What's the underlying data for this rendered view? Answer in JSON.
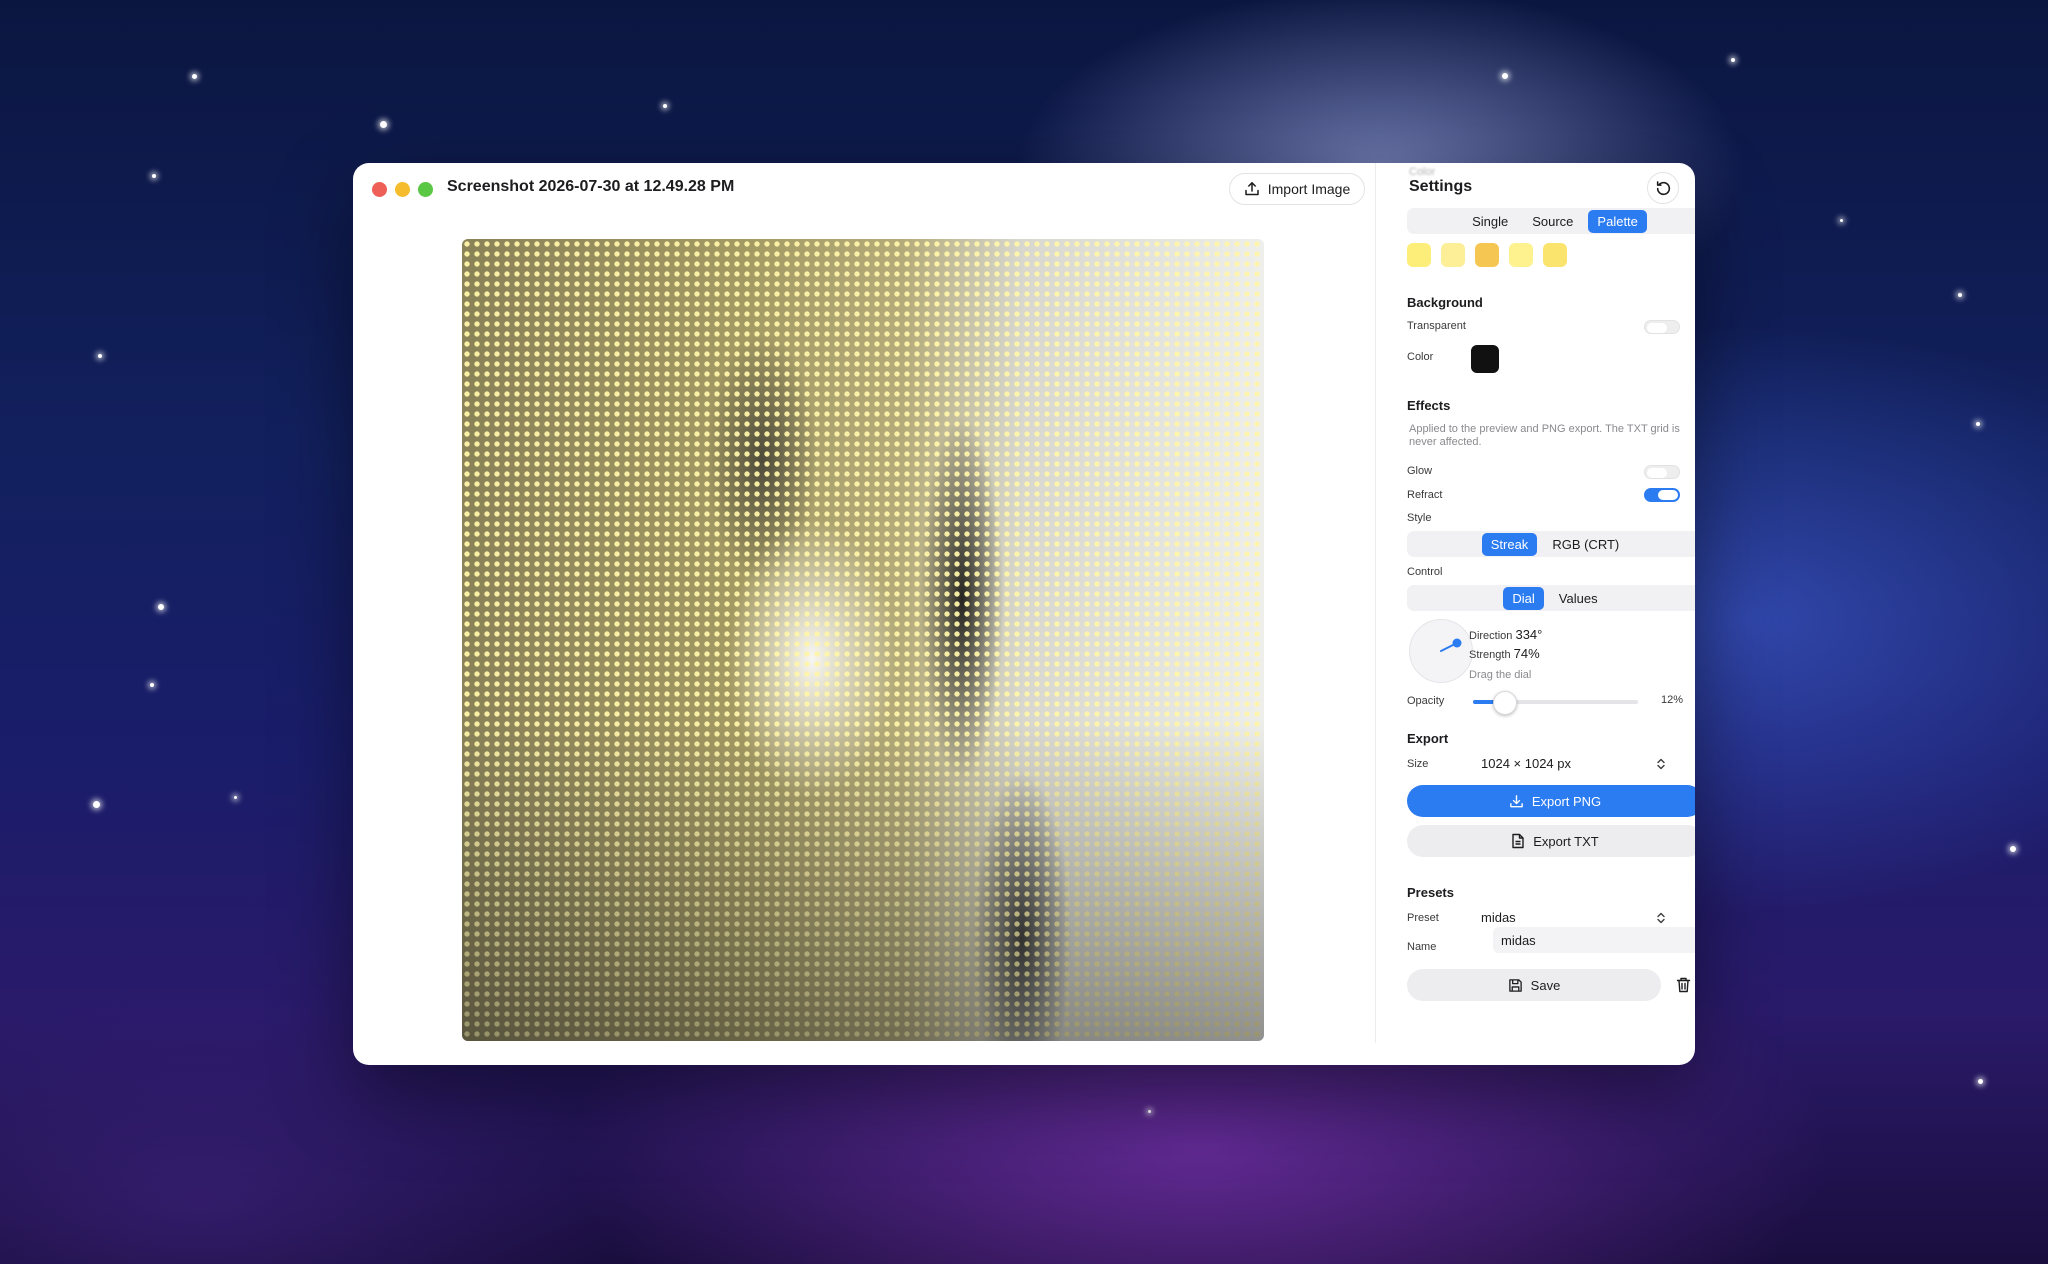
{
  "window": {
    "title": "Screenshot 2026-07-30 at 12.49.28 PM",
    "import_label": "Import Image",
    "traffic_colors": [
      "#ee5f57",
      "#f5bd2e",
      "#5ac844"
    ]
  },
  "sidebar": {
    "title": "Settings",
    "ghost_label": "Color",
    "color_mode": {
      "options": [
        "Single",
        "Source",
        "Palette"
      ],
      "selected": "Palette"
    },
    "palette": [
      "#fdee7a",
      "#fcef98",
      "#f6c653",
      "#fdf28e",
      "#fbe46e"
    ],
    "background": {
      "title": "Background",
      "transparent_label": "Transparent",
      "transparent": false,
      "color_label": "Color",
      "color": "#111111"
    },
    "effects": {
      "title": "Effects",
      "note": "Applied to the preview and PNG export. The TXT grid is never affected.",
      "glow_label": "Glow",
      "glow": false,
      "refract_label": "Refract",
      "refract": true,
      "style_label": "Style",
      "style": {
        "options": [
          "Streak",
          "RGB (CRT)"
        ],
        "selected": "Streak"
      },
      "control_label": "Control",
      "control": {
        "options": [
          "Dial",
          "Values"
        ],
        "selected": "Dial"
      },
      "direction_label": "Direction",
      "direction": "334°",
      "strength_label": "Strength",
      "strength": "74%",
      "dial_hint": "Drag the dial",
      "opacity_label": "Opacity",
      "opacity": "12%",
      "opacity_value": 0.12
    },
    "export": {
      "title": "Export",
      "size_label": "Size",
      "size": "1024 × 1024 px",
      "png_label": "Export PNG",
      "txt_label": "Export TXT"
    },
    "presets": {
      "title": "Presets",
      "preset_label": "Preset",
      "preset": "midas",
      "name_label": "Name",
      "name": "midas",
      "save_label": "Save"
    }
  },
  "colors": {
    "accent": "#2b7bf1"
  }
}
